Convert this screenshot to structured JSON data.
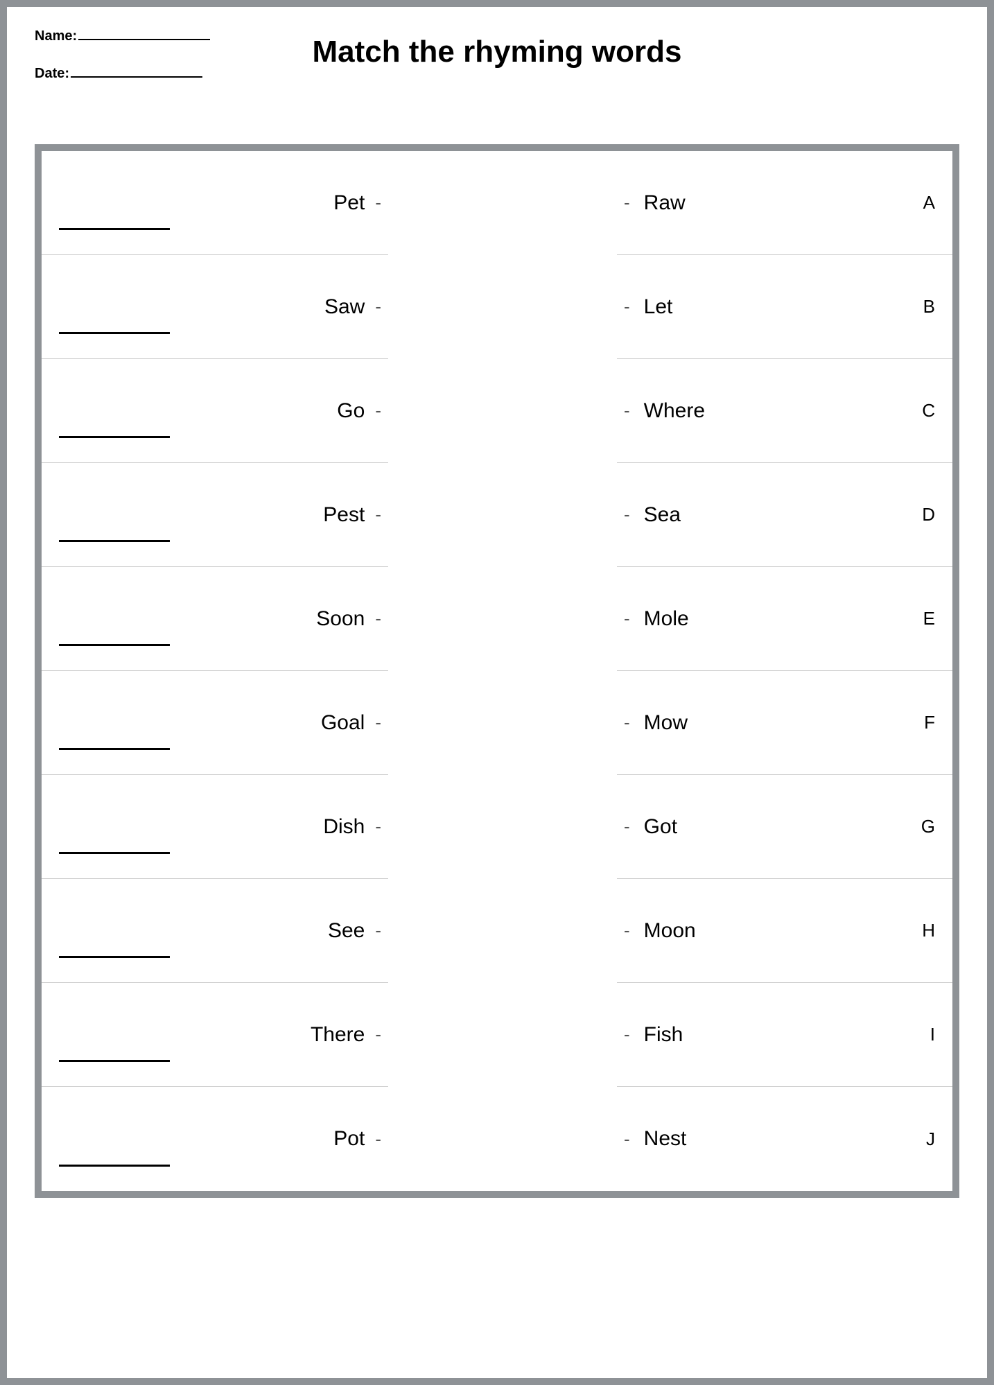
{
  "header": {
    "name_label": "Name:",
    "date_label": "Date:",
    "title": "Match the rhyming words"
  },
  "rows": [
    {
      "left": "Pet",
      "right": "Raw",
      "letter": "A"
    },
    {
      "left": "Saw",
      "right": "Let",
      "letter": "B"
    },
    {
      "left": "Go",
      "right": "Where",
      "letter": "C"
    },
    {
      "left": "Pest",
      "right": "Sea",
      "letter": "D"
    },
    {
      "left": "Soon",
      "right": "Mole",
      "letter": "E"
    },
    {
      "left": "Goal",
      "right": "Mow",
      "letter": "F"
    },
    {
      "left": "Dish",
      "right": "Got",
      "letter": "G"
    },
    {
      "left": "See",
      "right": "Moon",
      "letter": "H"
    },
    {
      "left": "There",
      "right": "Fish",
      "letter": "I"
    },
    {
      "left": "Pot",
      "right": "Nest",
      "letter": "J"
    }
  ],
  "dash": "-"
}
